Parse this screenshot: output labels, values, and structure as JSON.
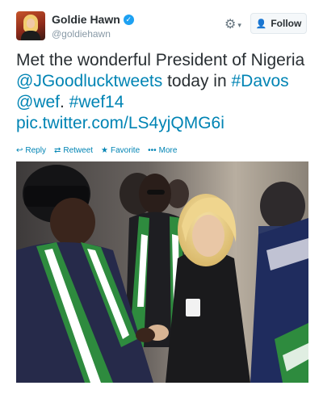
{
  "author": {
    "display_name": "Goldie Hawn",
    "handle": "@goldiehawn",
    "verified_icon": "verified-check-icon"
  },
  "header": {
    "gear_icon": "gear-icon",
    "follow_label": "Follow"
  },
  "tweet": {
    "text_before": "Met the wonderful President of Nigeria ",
    "mention": "@JGoodlucktweets",
    "text_middle": " today in ",
    "hashtag_davos": "#Davos",
    "mention_wef": "@wef",
    "hashtag_wef14": "#wef14",
    "link": "pic.twitter.com/LS4yjQMG6i"
  },
  "actions": [
    {
      "label": "Reply",
      "icon": "reply-icon"
    },
    {
      "label": "Retweet",
      "icon": "retweet-icon"
    },
    {
      "label": "Favorite",
      "icon": "star-icon"
    },
    {
      "label": "More",
      "icon": "more-dots-icon"
    }
  ],
  "colors": {
    "link": "#0084b4",
    "text": "#292f33",
    "muted": "#8899a6",
    "verified": "#1da1f2"
  }
}
